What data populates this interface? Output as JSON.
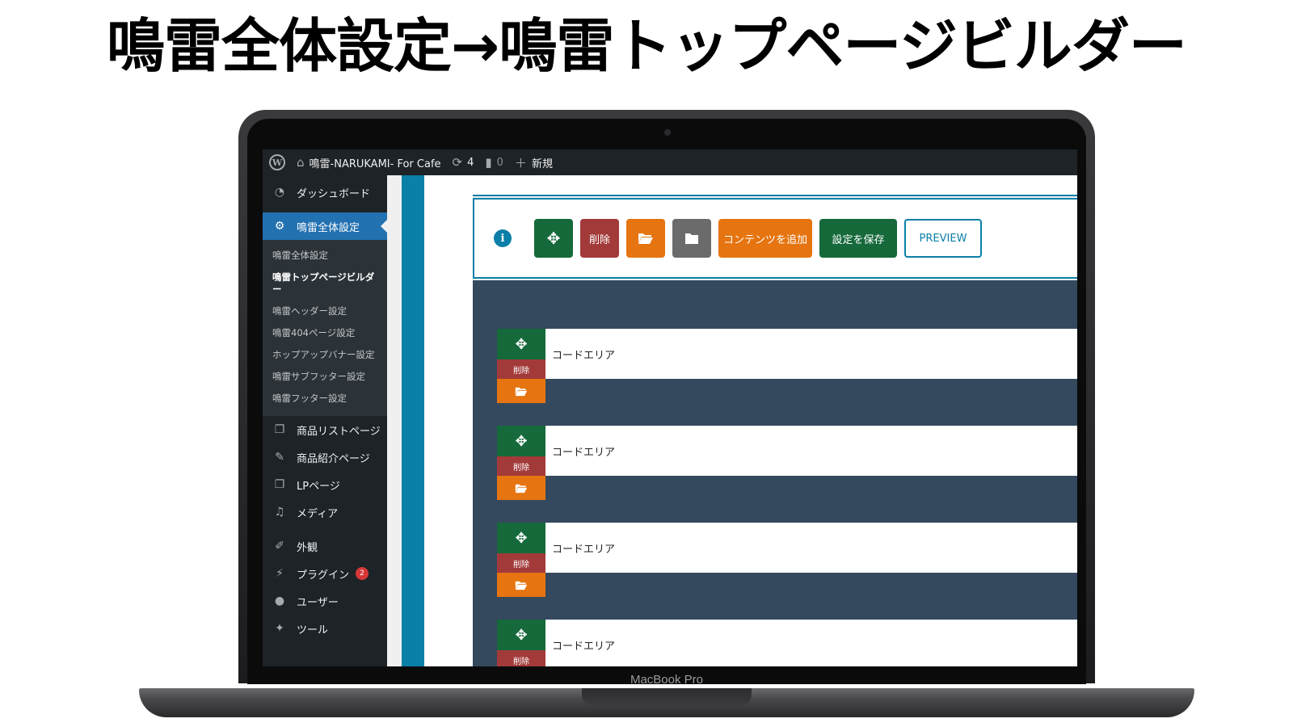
{
  "headline": "鳴雷全体設定→鳴雷トップページビルダー",
  "device": {
    "brand": "MacBook Pro"
  },
  "admin_bar": {
    "wp_logo": "W",
    "site_name": "鳴雷-NARUKAMI- For Cafe",
    "updates": "4",
    "comments": "0",
    "new_label": "新規",
    "icons": {
      "home": "home-icon",
      "updates": "refresh-icon",
      "comments": "comment-icon",
      "new": "plus-icon"
    }
  },
  "sidebar": {
    "dashboard": "ダッシュボード",
    "current": "鳴雷全体設定",
    "submenu": [
      "鳴雷全体設定",
      "鳴雷トップページビルダー",
      "鳴雷ヘッダー設定",
      "鳴雷404ページ設定",
      "ホップアップバナー設定",
      "鳴雷サブフッター設定",
      "鳴雷フッター設定"
    ],
    "items": [
      "商品リストページ",
      "商品紹介ページ",
      "LPページ",
      "メディア",
      "外観",
      "プラグイン",
      "ユーザー",
      "ツール"
    ],
    "plugins_badge": "2"
  },
  "toolbar": {
    "info": "i",
    "move_icon": "✥",
    "delete_label": "削除",
    "open_icon": "open-folder-icon",
    "folder_icon": "folder-icon",
    "add_content_label": "コンテンツを追加",
    "save_label": "設定を保存",
    "preview_label": "PREVIEW"
  },
  "rows": [
    {
      "label": "コードエリア",
      "delete_label": "削除"
    },
    {
      "label": "コードエリア",
      "delete_label": "削除"
    },
    {
      "label": "コードエリア",
      "delete_label": "削除"
    },
    {
      "label": "コードエリア",
      "delete_label": "削除"
    }
  ],
  "colors": {
    "admin_bar": "#1d2327",
    "accent_blue": "#2271b1",
    "teal": "#0a7fa8",
    "green": "#15693a",
    "red": "#a33a3a",
    "orange": "#e67410",
    "gray": "#6b6b6b",
    "builder_bg": "#34495e"
  }
}
